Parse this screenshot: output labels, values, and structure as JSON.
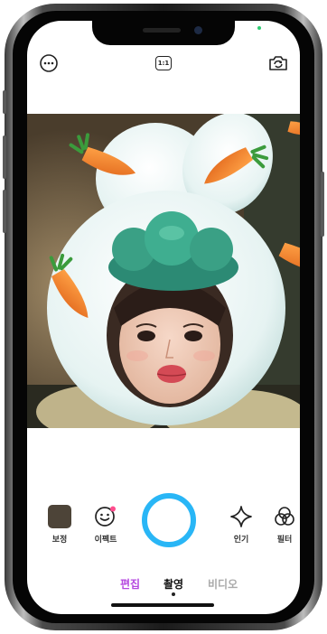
{
  "top_bar": {
    "menu_icon": "more-horizontal-icon",
    "aspect_ratio_label": "1:1",
    "flip_icon": "camera-flip-icon"
  },
  "camera": {
    "filter": "rabbit-hat-carrots"
  },
  "tools": {
    "adjust_label": "보정",
    "effects_label": "이펙트",
    "popular_label": "인기",
    "filter_label": "필터"
  },
  "modes": {
    "edit": "편집",
    "photo": "촬영",
    "video": "비디오",
    "active": "촬영"
  },
  "colors": {
    "accent": "#29b6f6",
    "edit_mode": "#b548e0",
    "swatch": "#4d4438"
  }
}
